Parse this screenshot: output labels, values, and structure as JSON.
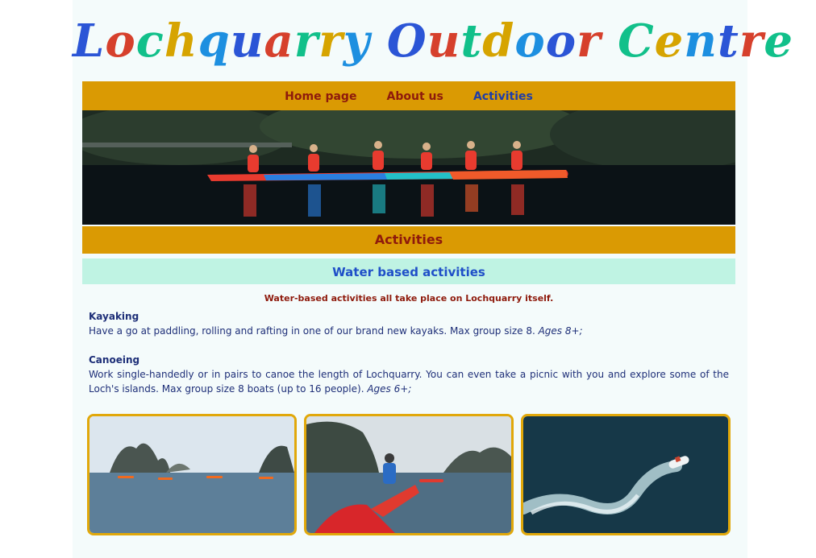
{
  "site": {
    "title": "Lochquarry Outdoor Centre",
    "title_colors": [
      "#2b55d6",
      "#d6402c",
      "#11c08a",
      "#d6a400",
      "#1d8fe0"
    ]
  },
  "nav": {
    "items": [
      {
        "label": "Home page"
      },
      {
        "label": "About us"
      },
      {
        "label": "Activities"
      }
    ],
    "active_index": 2
  },
  "hero": {
    "alt": "Group of kayakers paddling on a dark loch at dusk"
  },
  "page": {
    "heading": "Activities",
    "subheading": "Water based activities",
    "intro": "Water-based activities all take place on Lochquarry itself."
  },
  "activities": [
    {
      "name": "Kayaking",
      "description": "Have a go at paddling, rolling and rafting in one of our brand new kayaks. Max group size 8.",
      "ages": "Ages 8+;"
    },
    {
      "name": "Canoeing",
      "description": "Work single-handedly or in pairs to canoe the length of Lochquarry. You can even take a picnic with you and explore some of the Loch's islands. Max group size 8 boats (up to 16 people).",
      "ages": "Ages 6+;"
    }
  ],
  "photos": [
    {
      "alt": "Kayaks on calm water among rocky islands"
    },
    {
      "alt": "Paddlers in red kayaks near limestone cliffs"
    },
    {
      "alt": "Aerial view of a speedboat leaving a white wake"
    }
  ],
  "colors": {
    "nav_bg": "#da9a03",
    "nav_text": "#8e1a0c",
    "nav_active": "#1f3da8",
    "sub_bg": "#bff3e3",
    "sub_text": "#1f4fc8",
    "body_text": "#1e2f78",
    "photo_border": "#e1a80a"
  }
}
